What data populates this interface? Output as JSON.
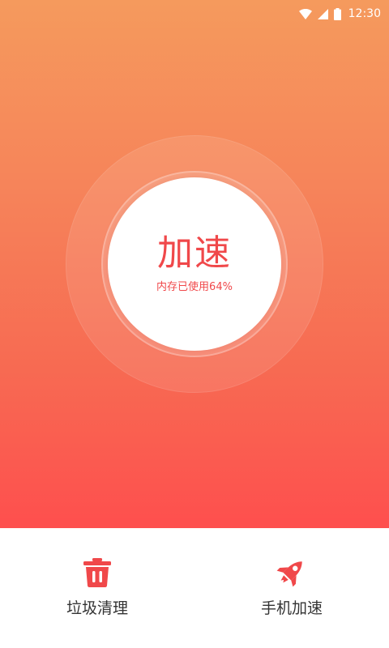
{
  "status_bar": {
    "time": "12:30",
    "icons": [
      "wifi-icon",
      "signal-icon",
      "battery-icon"
    ]
  },
  "booster": {
    "title": "加速",
    "memory_usage_text": "内存已使用64%",
    "memory_used_percent": 64
  },
  "bottom_nav": {
    "items": [
      {
        "label": "垃圾清理",
        "icon": "trash-icon"
      },
      {
        "label": "手机加速",
        "icon": "rocket-icon"
      }
    ]
  },
  "colors": {
    "gradient_top": "#f59a5d",
    "gradient_bottom": "#fe4f4e",
    "accent": "#f0484a",
    "nav_label": "#333333"
  }
}
